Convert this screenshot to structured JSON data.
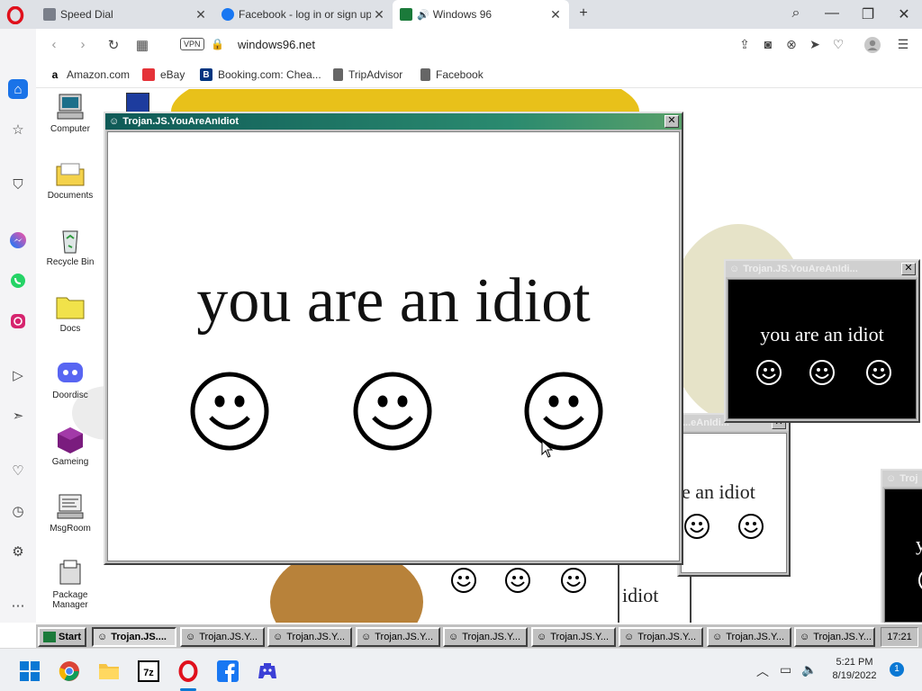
{
  "browser": {
    "tabs": [
      {
        "title": "Speed Dial",
        "close": "✕"
      },
      {
        "title": "Facebook - log in or sign up",
        "close": "✕"
      },
      {
        "title": "Windows 96",
        "close": "✕"
      }
    ],
    "new_tab": "+",
    "address": {
      "vpn": "VPN",
      "url": "windows96.net"
    },
    "bookmarks": [
      {
        "label": "Amazon.com",
        "icon": "amazon-icon"
      },
      {
        "label": "eBay",
        "icon": "ebay-icon"
      },
      {
        "label": "Booking.com: Chea...",
        "icon": "booking-icon"
      },
      {
        "label": "TripAdvisor",
        "icon": "page-icon"
      },
      {
        "label": "Facebook",
        "icon": "page-icon"
      }
    ]
  },
  "desktop": {
    "icons": [
      {
        "label": "Computer"
      },
      {
        "label": "Documents"
      },
      {
        "label": "Recycle Bin"
      },
      {
        "label": "Docs"
      },
      {
        "label": "Doordisc"
      },
      {
        "label": "Gameing"
      },
      {
        "label": "MsgRoom"
      },
      {
        "label": "Package Manager"
      }
    ]
  },
  "windows": {
    "main": {
      "title": "Trojan.JS.YouAreAnIdiot",
      "text": "you are an idiot"
    },
    "right_black": {
      "title": "Trojan.JS.YouAreAnIdi...",
      "text": "you are an idiot"
    },
    "mid_white": {
      "title": "...eAnIdi...",
      "text": "e an idiot"
    },
    "bottom_partial": {
      "text": "idiot"
    },
    "far_right": {
      "title": "Troj",
      "text": "y"
    }
  },
  "win96_taskbar": {
    "start": "Start",
    "items": [
      "Trojan.JS....",
      "Trojan.JS.Y...",
      "Trojan.JS.Y...",
      "Trojan.JS.Y...",
      "Trojan.JS.Y...",
      "Trojan.JS.Y...",
      "Trojan.JS.Y...",
      "Trojan.JS.Y...",
      "Trojan.JS.Y..."
    ],
    "clock": "17:21"
  },
  "win11_taskbar": {
    "time": "5:21 PM",
    "date": "8/19/2022",
    "notifications": "1"
  },
  "colors": {
    "titlebar_active": "#0f5a57",
    "opera_red": "#e0101c",
    "win96_gray": "#c0c0c0"
  }
}
